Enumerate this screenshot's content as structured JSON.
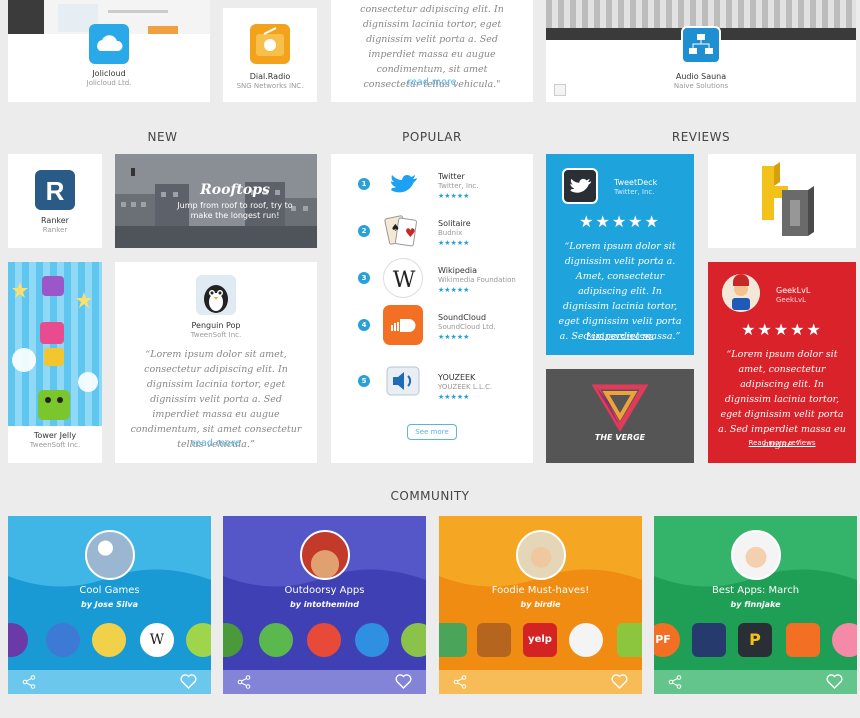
{
  "top_row": {
    "app1": {
      "name": "Jolicloud",
      "publisher": "Jolicloud Ltd."
    },
    "app2": {
      "name": "Dial.Radio",
      "publisher": "SNG Networks INC."
    },
    "quote": {
      "text": "consectetur adipiscing elit. In dignissim lacinia tortor, eget dignissim velit porta a. Sed imperdiet massa eu augue condimentum, sit amet consectetur tellus vehicula.\"",
      "read_more": "read more"
    },
    "app3": {
      "name": "Audio Sauna",
      "publisher": "Naive Solutions"
    }
  },
  "sections": {
    "new": "NEW",
    "popular": "POPULAR",
    "reviews": "REVIEWS",
    "community": "COMMUNITY"
  },
  "new": {
    "ranker": {
      "name": "Ranker",
      "publisher": "Ranker"
    },
    "rooftops": {
      "title": "Rooftops",
      "tagline": "Jump from roof to roof, try to make the longest run!"
    },
    "tower": {
      "name": "Tower Jelly",
      "publisher": "TweenSoft Inc."
    },
    "penguin": {
      "name": "Penguin Pop",
      "publisher": "TweenSoft Inc.",
      "quote": "“Lorem ipsum dolor sit amet, consectetur adipiscing elit. In dignissim lacinia tortor, eget dignissim velit porta a. Sed imperdiet massa eu augue condimentum, sit amet consectetur tellus vehicula.”",
      "read_more": "read more"
    }
  },
  "popular": {
    "items": [
      {
        "rank": "1",
        "name": "Twitter",
        "publisher": "Twitter, Inc.",
        "stars": "★★★★★"
      },
      {
        "rank": "2",
        "name": "Solitaire",
        "publisher": "Budnix",
        "stars": "★★★★★"
      },
      {
        "rank": "3",
        "name": "Wikipedia",
        "publisher": "Wikimedia Foundation",
        "stars": "★★★★★"
      },
      {
        "rank": "4",
        "name": "SoundCloud",
        "publisher": "SoundCloud Ltd.",
        "stars": "★★★★★"
      },
      {
        "rank": "5",
        "name": "YOUZEEK",
        "publisher": "YOUZEEK L.L.C.",
        "stars": "★★★★★"
      }
    ],
    "see_more": "See more"
  },
  "reviews": {
    "tweetdeck": {
      "name": "TweetDeck",
      "publisher": "Twitter, Inc.",
      "rating": 4,
      "stars": "★★★★★",
      "quote": "“Lorem ipsum dolor sit dignissim velit porta a. Amet, consectetur adipiscing elit. In dignissim lacinia tortor, eget dignissim velit porta a. Sed imperdiet massa.”",
      "link": "Read more reviews",
      "color": "#1fa3dc"
    },
    "geeklvl": {
      "name": "GeekLvL",
      "publisher": "GeekLvL",
      "rating": 5,
      "stars": "★★★★★",
      "quote": "“Lorem ipsum dolor sit amet, consectetur adipiscing elit. In dignissim lacinia tortor, eget dignissim velit porta a. Sed imperdiet massa eu augue.”",
      "link": "Read more reviews",
      "color": "#d9222a"
    },
    "verge": {
      "logo_text": "THE VERGE"
    }
  },
  "community": [
    {
      "title": "Cool Games",
      "by": "by Jose Silva",
      "color": "#3fb6e6",
      "bar": "#6cc7ec"
    },
    {
      "title": "Outdoorsy Apps",
      "by": "by intothemind",
      "color": "#5557c8",
      "bar": "#8384d8"
    },
    {
      "title": "Foodie Must-haves!",
      "by": "by birdie",
      "color": "#f5a623",
      "bar": "#f7bb58"
    },
    {
      "title": "Best Apps: March",
      "by": "by finnjake",
      "color": "#34b36a",
      "bar": "#63c58c"
    }
  ]
}
